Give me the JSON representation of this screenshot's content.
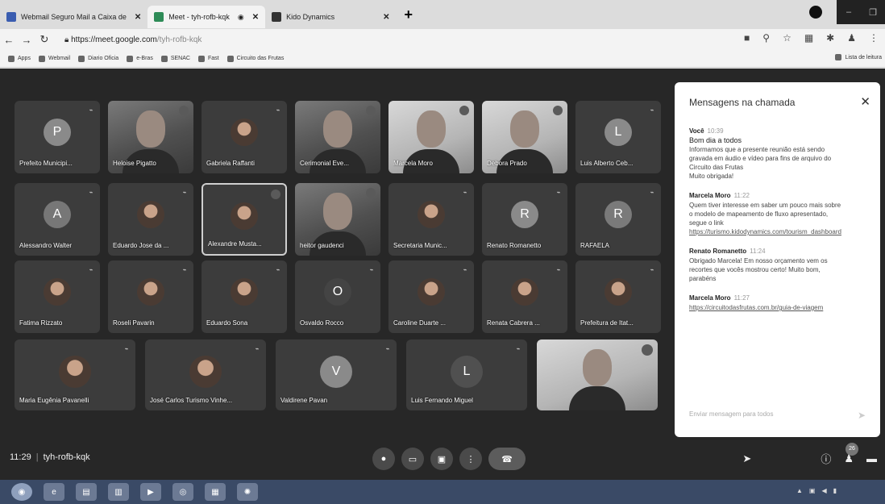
{
  "browser": {
    "tabs": [
      {
        "label": "Webmail Seguro Mail a Caixa de",
        "color": "#3a5db0"
      },
      {
        "label": "Meet - tyh-rofb-kqk",
        "color": "#2e8b57"
      },
      {
        "label": "Kido Dynamics",
        "color": "#333333"
      }
    ],
    "url_host": "https://meet.google.com",
    "url_path": "/tyh-rofb-kqk",
    "bookmarks": [
      "Apps",
      "Webmail",
      "Diario Oficia",
      "e-Bras",
      "SENAC",
      "Fast",
      "Circuito das Frutas"
    ],
    "reading_list": "Lista de leitura"
  },
  "meet": {
    "meeting_time": "11:29",
    "meeting_code": "tyh-rofb-kqk",
    "participant_count": "26",
    "row1": [
      {
        "name": "Prefeito Municipi...",
        "kind": "avatar",
        "initial": "P",
        "color": "#8a8a8a"
      },
      {
        "name": "Heloise Pigatto",
        "kind": "video"
      },
      {
        "name": "Gabriela Raffanti",
        "kind": "photo"
      },
      {
        "name": "Cerimonial Eve...",
        "kind": "video"
      },
      {
        "name": "Marcela Moro",
        "kind": "video-light"
      },
      {
        "name": "Debora Prado",
        "kind": "video-light"
      },
      {
        "name": "Luis Alberto Ceb...",
        "kind": "avatar",
        "initial": "L",
        "color": "#8a8a8a"
      }
    ],
    "row2": [
      {
        "name": "Alessandro Walter",
        "kind": "avatar",
        "initial": "A",
        "color": "#777777"
      },
      {
        "name": "Eduardo Jose da ...",
        "kind": "photo"
      },
      {
        "name": "Alexandre Musta...",
        "kind": "photo"
      },
      {
        "name": "heitor gaudenci",
        "kind": "video"
      },
      {
        "name": "Secretaria Munic...",
        "kind": "photo"
      },
      {
        "name": "Renato Romanetto",
        "kind": "avatar",
        "initial": "R",
        "color": "#8a8a8a"
      },
      {
        "name": "RAFAELA",
        "kind": "avatar",
        "initial": "R",
        "color": "#7a7a7a"
      }
    ],
    "row3": [
      {
        "name": "Fatima Rizzato",
        "kind": "photo"
      },
      {
        "name": "Roseli Pavarin",
        "kind": "photo"
      },
      {
        "name": "Eduardo Sona",
        "kind": "photo"
      },
      {
        "name": "Osvaldo Rocco",
        "kind": "avatar",
        "initial": "O",
        "color": "#444444"
      },
      {
        "name": "Caroline Duarte ...",
        "kind": "photo"
      },
      {
        "name": "Renata Cabrera ...",
        "kind": "photo"
      },
      {
        "name": "Prefeitura de Itat...",
        "kind": "photo"
      }
    ],
    "row4": [
      {
        "name": "Maria Eugênia Pavanelli",
        "kind": "photo"
      },
      {
        "name": "José Carlos Turismo Vinhe...",
        "kind": "photo"
      },
      {
        "name": "Valdirene Pavan",
        "kind": "avatar",
        "initial": "V",
        "color": "#8a8a8a"
      },
      {
        "name": "Luis Fernando Miguel",
        "kind": "avatar",
        "initial": "L",
        "color": "#505050"
      },
      {
        "name": "",
        "kind": "video-light"
      }
    ]
  },
  "chat": {
    "title": "Mensagens na chamada",
    "input_placeholder": "Enviar mensagem para todos",
    "messages": [
      {
        "author": "Você",
        "time": "10:39",
        "lines": [
          "Bom dia a todos",
          "Informamos que a presente reunião está sendo",
          "gravada em áudio e vídeo para fins de arquivo do",
          "Circuito das Frutas",
          "Muito obrigada!"
        ]
      },
      {
        "author": "Marcela Moro",
        "time": "11:22",
        "lines": [
          "Quem tiver interesse em saber um pouco mais sobre",
          "o modelo de mapeamento de fluxo apresentado,",
          "segue o link"
        ],
        "link": "https://turismo.kidodynamics.com/tourism_dashboard"
      },
      {
        "author": "Renato Romanetto",
        "time": "11:24",
        "lines": [
          "Obrigado Marcela! Em nosso orçamento vem os",
          "recortes que vocês mostrou certo! Muito bom,",
          "parabéns"
        ]
      },
      {
        "author": "Marcela Moro",
        "time": "11:27",
        "lines": [],
        "link": "https://circuitodasfrutas.com.br/guia-de-viagem"
      }
    ]
  }
}
